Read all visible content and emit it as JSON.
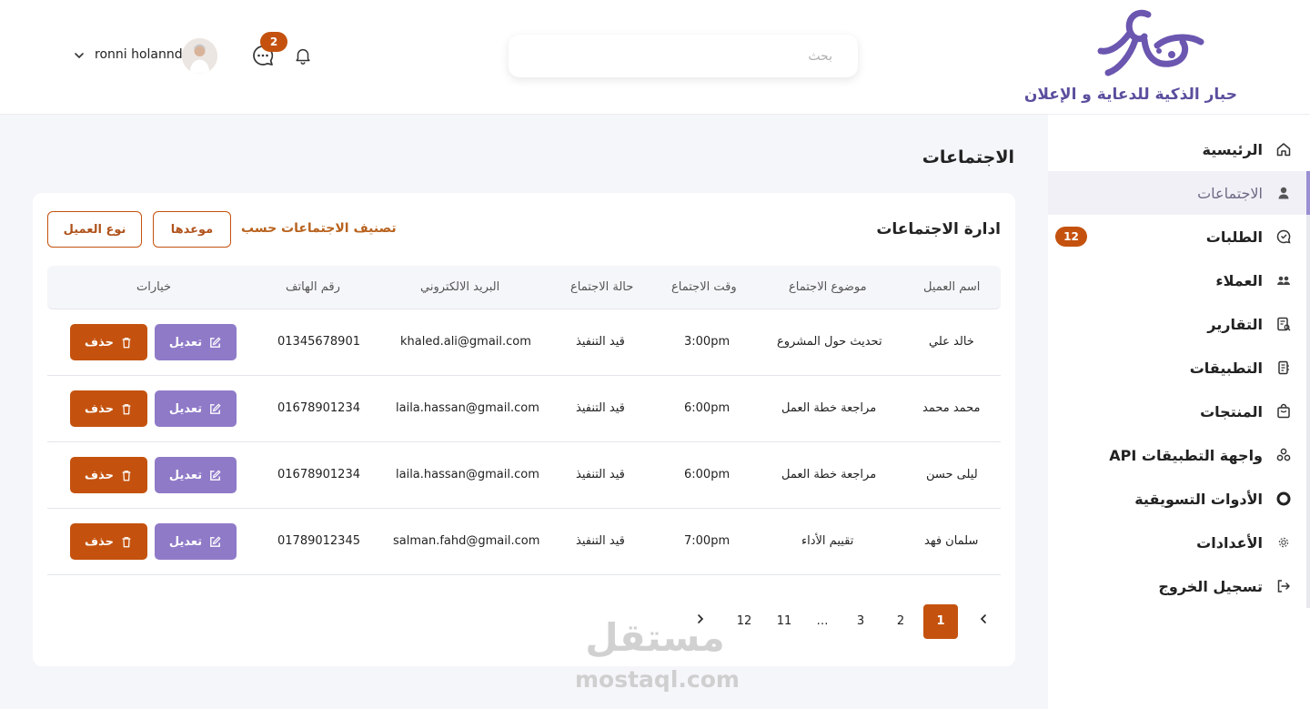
{
  "brand": {
    "name": "حبار الذكية للدعاية و الإعلان",
    "color": "#5b4f9e"
  },
  "header": {
    "search_placeholder": "بحث",
    "chat_badge": "2",
    "username": "ronni holannd"
  },
  "sidebar": {
    "items": [
      {
        "label": "الرئيسية",
        "icon": "home-icon"
      },
      {
        "label": "الاجتماعات",
        "icon": "user-icon",
        "active": true
      },
      {
        "label": "الطلبات",
        "icon": "chat-bubble-icon",
        "badge": "12"
      },
      {
        "label": "العملاء",
        "icon": "users-icon"
      },
      {
        "label": "التقارير",
        "icon": "report-icon"
      },
      {
        "label": "التطبيقات",
        "icon": "app-icon"
      },
      {
        "label": "المنتجات",
        "icon": "bag-icon"
      },
      {
        "label": "واجهة التطبيقات API",
        "icon": "api-icon"
      },
      {
        "label": "الأدوات التسويقية",
        "icon": "circle-icon"
      },
      {
        "label": "الأعدادات",
        "icon": "gear-icon"
      },
      {
        "label": "تسجيل الخروج",
        "icon": "logout-icon"
      }
    ]
  },
  "page": {
    "title": "الاجتماعات"
  },
  "card": {
    "title": "ادارة الاجتماعات",
    "filter_label": "تصنيف الاجتماعات حسب",
    "filter_date": "موعدها",
    "filter_client_type": "نوع العميل"
  },
  "table": {
    "headers": {
      "client": "اسم العميل",
      "topic": "موضوع الاجتماع",
      "time": "وقت الاجتماع",
      "status": "حالة الاجتماع",
      "email": "البريد الالكتروني",
      "phone": "رقم الهاتف",
      "options": "خيارات"
    },
    "rows": [
      {
        "client": "خالد علي",
        "topic": "تحديث حول المشروع",
        "time": "3:00pm",
        "status": "قيد التنفيذ",
        "email": "khaled.ali@gmail.com",
        "phone": "01345678901"
      },
      {
        "client": "محمد محمد",
        "topic": "مراجعة خطة العمل",
        "time": "6:00pm",
        "status": "قيد التنفيذ",
        "email": "laila.hassan@gmail.com",
        "phone": "01678901234"
      },
      {
        "client": "ليلى حسن",
        "topic": "مراجعة خطة العمل",
        "time": "6:00pm",
        "status": "قيد التنفيذ",
        "email": "laila.hassan@gmail.com",
        "phone": "01678901234"
      },
      {
        "client": "سلمان فهد",
        "topic": "تقييم الأداء",
        "time": "7:00pm",
        "status": "قيد التنفيذ",
        "email": "salman.fahd@gmail.com",
        "phone": "01789012345"
      }
    ],
    "edit_label": "تعديل",
    "delete_label": "حذف"
  },
  "pagination": {
    "pages": [
      "1",
      "2",
      "3",
      "…",
      "11",
      "12"
    ],
    "current": "1"
  },
  "watermark": {
    "arabic": "مستقل",
    "latin": "mostaql.com"
  },
  "colors": {
    "accent": "#c4520e",
    "edit": "#8f7ac8",
    "brand": "#5b4f9e"
  }
}
